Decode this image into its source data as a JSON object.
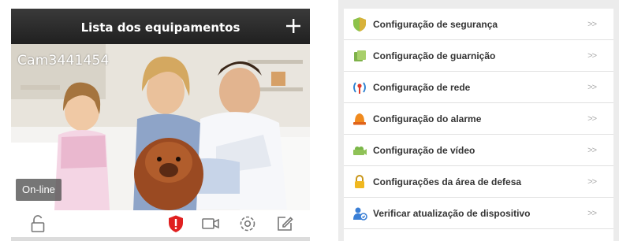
{
  "device_list": {
    "title": "Lista dos equipamentos",
    "add_icon": "plus-icon",
    "camera": {
      "name": "Cam3441454",
      "status": "On-line"
    },
    "toolbar_icons": [
      "unlock-icon",
      "shield-alert-icon",
      "video-camera-icon",
      "settings-gear-icon",
      "edit-icon"
    ],
    "colors": {
      "header": "#2b2b2b",
      "alert": "#e02020"
    }
  },
  "settings_menu": {
    "items": [
      {
        "label": "Configuração de segurança",
        "icon": "shield-icon",
        "arrow": ">>"
      },
      {
        "label": "Configuração de guarnição",
        "icon": "guard-icon",
        "arrow": ">>"
      },
      {
        "label": "Configuração de rede",
        "icon": "network-icon",
        "arrow": ">>"
      },
      {
        "label": "Configuração do alarme",
        "icon": "alarm-bell-icon",
        "arrow": ">>"
      },
      {
        "label": "Configuração de vídeo",
        "icon": "video-icon",
        "arrow": ">>"
      },
      {
        "label": "Configurações da área de defesa",
        "icon": "lock-icon",
        "arrow": ">>"
      },
      {
        "label": "Verificar atualização de dispositivo",
        "icon": "user-update-icon",
        "arrow": ">>"
      }
    ]
  }
}
